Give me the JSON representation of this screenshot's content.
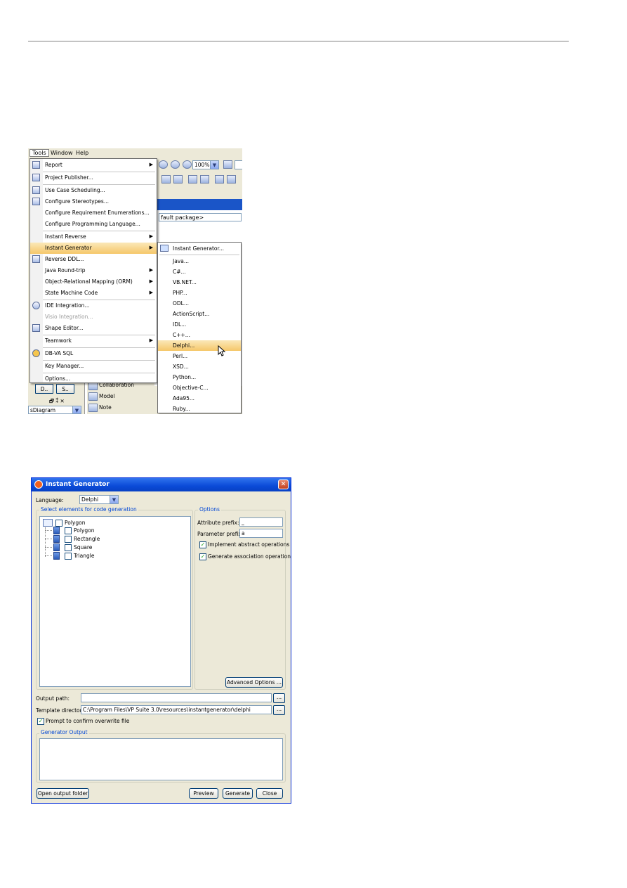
{
  "menubar": {
    "tools": "Tools",
    "window": "Window",
    "help": "Help"
  },
  "toolbar": {
    "zoom": "100%"
  },
  "path_bar": "fault package>",
  "tools_menu": [
    {
      "label": "Report",
      "arrow": "▶"
    },
    {
      "label": "Project Publisher..."
    },
    {
      "label": "Use Case Scheduling..."
    },
    {
      "label": "Configure Stereotypes..."
    },
    {
      "label": "Configure Requirement Enumerations..."
    },
    {
      "label": "Configure Programming Language..."
    },
    {
      "label": "Instant Reverse",
      "arrow": "▶"
    },
    {
      "label": "Instant Generator",
      "arrow": "▶"
    },
    {
      "label": "Reverse DDL..."
    },
    {
      "label": "Java Round-trip",
      "arrow": "▶"
    },
    {
      "label": "Object-Relational Mapping (ORM)",
      "arrow": "▶"
    },
    {
      "label": "State Machine Code",
      "arrow": "▶"
    },
    {
      "label": "IDE Integration..."
    },
    {
      "label": "Visio Integration..."
    },
    {
      "label": "Shape Editor..."
    },
    {
      "label": "Teamwork",
      "arrow": "▶"
    },
    {
      "label": "DB-VA SQL"
    },
    {
      "label": "Key Manager..."
    },
    {
      "label": "Options..."
    }
  ],
  "generator_submenu": [
    "Instant Generator...",
    "Java...",
    "C#...",
    "VB.NET...",
    "PHP...",
    "ODL...",
    "ActionScript...",
    "IDL...",
    "C++...",
    "Delphi...",
    "Perl...",
    "XSD...",
    "Python...",
    "Objective-C...",
    "Ada95...",
    "Ruby..."
  ],
  "background_panel": {
    "tabs": [
      "D..",
      "S.."
    ],
    "controls": "🗗 ⁑ ✕",
    "diagram_field": "sDiagram",
    "items": [
      "Collaboration",
      "Model",
      "Note"
    ]
  },
  "dialog": {
    "title": "Instant Generator",
    "close": "✕",
    "language_label": "Language:",
    "language_value": "Delphi",
    "select_group": "Select elements for code generation",
    "tree": {
      "root": "Polygon",
      "children": [
        "Polygon",
        "Rectangle",
        "Square",
        "Triangle"
      ]
    },
    "options_group": "Options",
    "attribute_prefix_label": "Attribute prefix:",
    "attribute_prefix_value": "_",
    "parameter_prefix_label": "Parameter prefix:",
    "parameter_prefix_value": "a",
    "implement_abstract": "Implement abstract operations",
    "generate_association": "Generate association operations",
    "advanced_options": "Advanced Options ...",
    "output_path_label": "Output path:",
    "output_path_value": "",
    "template_dir_label": "Template directory:",
    "template_dir_value": "C:\\Program Files\\VP Suite 3.0\\resources\\instantgenerator\\delphi",
    "browse": "...",
    "prompt_overwrite": "Prompt to confirm overwrite file",
    "generator_output_group": "Generator Output",
    "open_output_folder": "Open output folder",
    "preview": "Preview",
    "generate": "Generate",
    "close_button": "Close"
  },
  "colors": {
    "menu_highlight": "#f5c76a",
    "title_bar": "#0a4ad7",
    "group_title": "#0046d5"
  }
}
